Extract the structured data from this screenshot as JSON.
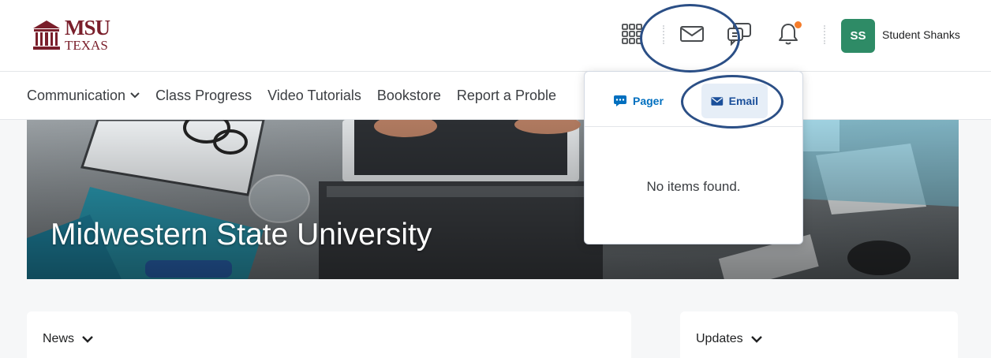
{
  "header": {
    "logo": {
      "line1": "MSU",
      "line2": "TEXAS"
    },
    "icons": [
      "grid-icon",
      "mail-icon",
      "chat-icon",
      "bell-icon"
    ],
    "user": {
      "initials": "SS",
      "name": "Student Shanks"
    },
    "colors": {
      "avatar": "#2e8b66",
      "notification": "#f57c2a",
      "brand": "#7a1f2b"
    }
  },
  "nav": {
    "items": [
      {
        "label": "Communication",
        "has_dropdown": true
      },
      {
        "label": "Class Progress"
      },
      {
        "label": "Video Tutorials"
      },
      {
        "label": "Bookstore"
      },
      {
        "label": "Report a Proble"
      }
    ]
  },
  "banner": {
    "title": "Midwestern State University"
  },
  "popup": {
    "tabs": [
      {
        "label": "Pager",
        "icon": "pager-chat-icon",
        "selected": false
      },
      {
        "label": "Email",
        "icon": "envelope-icon",
        "selected": true
      }
    ],
    "empty_message": "No items found."
  },
  "widgets": [
    {
      "title": "News"
    },
    {
      "title": "Updates"
    }
  ]
}
